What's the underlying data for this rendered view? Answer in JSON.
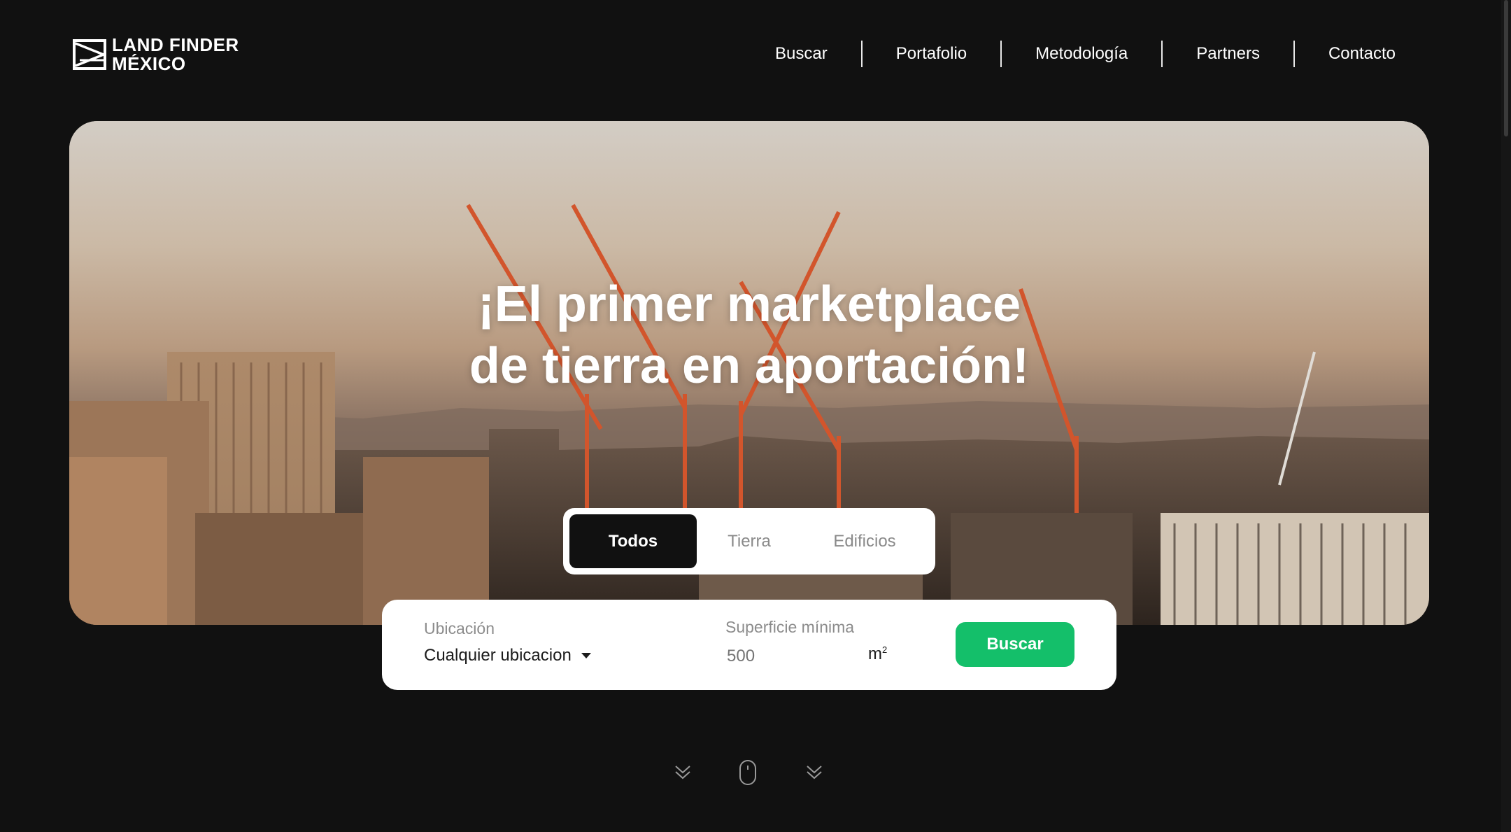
{
  "brand": {
    "line1": "LAND FINDER",
    "line2": "MÉXICO",
    "logo_icon": "envelope-frame-icon"
  },
  "nav": {
    "items": [
      {
        "label": "Buscar"
      },
      {
        "label": "Portafolio"
      },
      {
        "label": "Metodología"
      },
      {
        "label": "Partners"
      },
      {
        "label": "Contacto"
      }
    ]
  },
  "hero": {
    "title_line1": "¡El primer marketplace",
    "title_line2": "de tierra en aportación!"
  },
  "tabs": {
    "items": [
      {
        "label": "Todos",
        "active": true
      },
      {
        "label": "Tierra",
        "active": false
      },
      {
        "label": "Edificios",
        "active": false
      }
    ]
  },
  "search": {
    "location_label": "Ubicación",
    "location_value": "Cualquier ubicacion",
    "surface_label": "Superficie mínima",
    "surface_placeholder": "500",
    "unit": "m",
    "unit_exp": "2",
    "button_label": "Buscar",
    "button_color": "#14bf6a"
  },
  "scroll_hint": {
    "icons": [
      "chevron-double-down-icon",
      "mouse-icon",
      "chevron-double-down-icon"
    ]
  }
}
